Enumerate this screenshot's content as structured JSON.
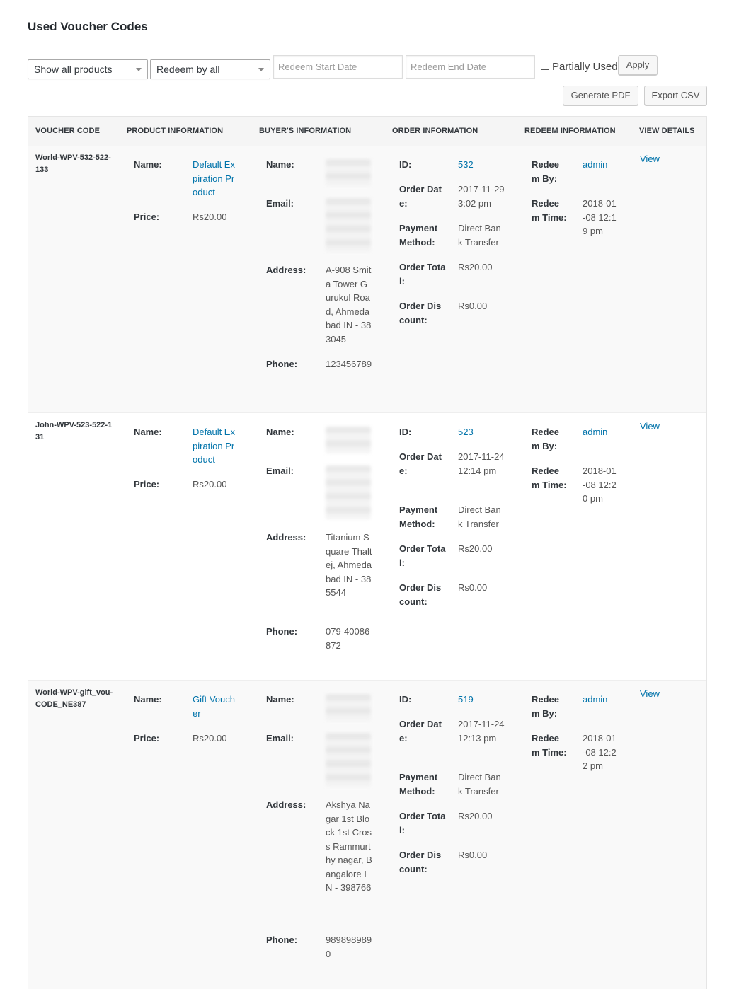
{
  "page": {
    "title": "Used Voucher Codes"
  },
  "filters": {
    "product_select": "Show all products",
    "redeem_select": "Redeem by all",
    "start_date_placeholder": "Redeem Start Date",
    "end_date_placeholder": "Redeem End Date",
    "partially_used_label": "Partially Used",
    "apply_label": "Apply",
    "generate_pdf_label": "Generate PDF",
    "export_csv_label": "Export CSV"
  },
  "table": {
    "headers": [
      "VOUCHER CODE",
      "PRODUCT INFORMATION",
      "BUYER'S INFORMATION",
      "ORDER INFORMATION",
      "REDEEM INFORMATION",
      "VIEW DETAILS"
    ],
    "labels": {
      "name": "Name:",
      "price": "Price:",
      "email": "Email:",
      "address": "Address:",
      "phone": "Phone:",
      "id": "ID:",
      "order_date": "Order Date:",
      "payment_method": "Payment Method:",
      "order_total": "Order Total:",
      "order_discount": "Order Discount:",
      "redeem_by": "Redeem By:",
      "redeem_time": "Redeem Time:",
      "view": "View"
    },
    "rows": [
      {
        "voucher_code": "World-WPV-532-522-133",
        "product_name": "Default Expiration Product",
        "price": "Rs20.00",
        "address": "A-908 Smita Tower Gurukul Road, Ahmedabad IN - 383045",
        "phone": "123456789",
        "order_id": "532",
        "order_date": "2017-11-29 3:02 pm",
        "payment_method": "Direct Bank Transfer",
        "order_total": "Rs20.00",
        "order_discount": "Rs0.00",
        "redeem_by": "admin",
        "redeem_time": "2018-01-08 12:19 pm"
      },
      {
        "voucher_code": "John-WPV-523-522-131",
        "product_name": "Default Expiration Product",
        "price": "Rs20.00",
        "address": "Titanium Square Thaltej, Ahmedabad IN - 385544",
        "phone": "079-40086872",
        "order_id": "523",
        "order_date": "2017-11-24 12:14 pm",
        "payment_method": "Direct Bank Transfer",
        "order_total": "Rs20.00",
        "order_discount": "Rs0.00",
        "redeem_by": "admin",
        "redeem_time": "2018-01-08 12:20 pm"
      },
      {
        "voucher_code": "World-WPV-gift_vou-CODE_NE387",
        "product_name": "Gift Voucher",
        "price": "Rs20.00",
        "address": "Akshya Nagar 1st Block 1st Cross Rammurthy nagar, Bangalore IN - 398766",
        "phone": "9898989890",
        "order_id": "519",
        "order_date": "2017-11-24 12:13 pm",
        "payment_method": "Direct Bank Transfer",
        "order_total": "Rs20.00",
        "order_discount": "Rs0.00",
        "redeem_by": "admin",
        "redeem_time": "2018-01-08 12:22 pm"
      }
    ]
  }
}
